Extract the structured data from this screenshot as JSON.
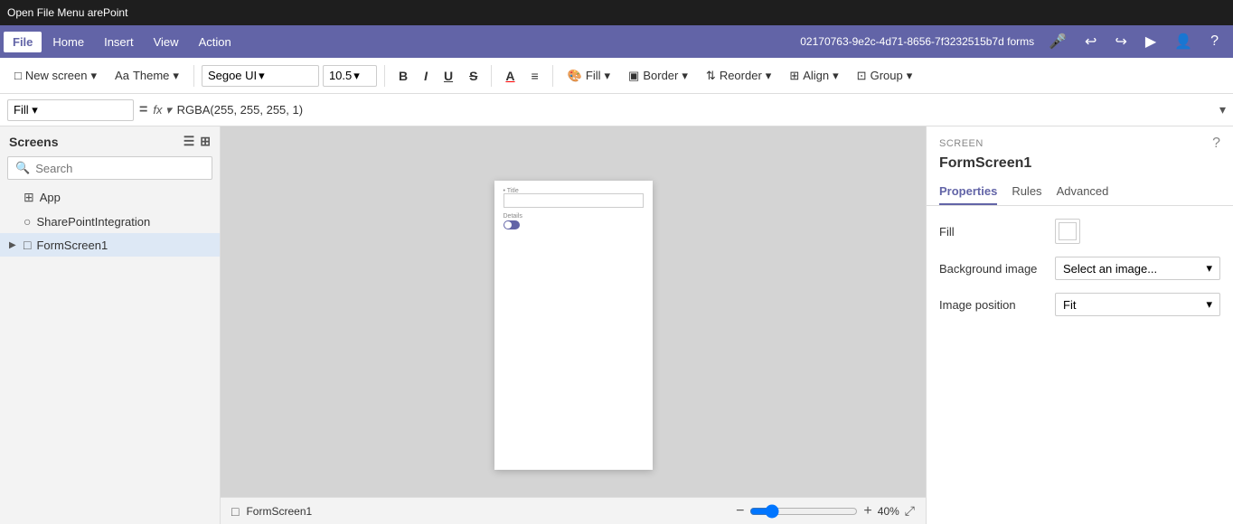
{
  "titleBar": {
    "text": "Open File Menu arePoint"
  },
  "menuBar": {
    "appId": "02170763-9e2c-4d71-8656-7f3232515b7d forms",
    "items": [
      {
        "id": "file",
        "label": "File",
        "active": true
      },
      {
        "id": "home",
        "label": "Home",
        "active": false
      },
      {
        "id": "insert",
        "label": "Insert",
        "active": false
      },
      {
        "id": "view",
        "label": "View",
        "active": false
      },
      {
        "id": "action",
        "label": "Action",
        "active": false
      }
    ],
    "icons": [
      "🎤",
      "↩",
      "↪",
      "▶",
      "👤",
      "?"
    ]
  },
  "toolbar": {
    "newScreen": "New screen",
    "theme": "Theme",
    "fontFamily": "Segoe UI",
    "fontSize": "10.5",
    "bold": "B",
    "italic": "I",
    "underline": "U",
    "strikethrough": "S",
    "fontColor": "A",
    "textAlign": "≡",
    "fill": "Fill",
    "border": "Border",
    "reorder": "Reorder",
    "align": "Align",
    "group": "Group"
  },
  "formulaBar": {
    "property": "Fill",
    "formula": "RGBA(255, 255, 255, 1)"
  },
  "screens": {
    "title": "Screens",
    "search": {
      "placeholder": "Search",
      "value": ""
    },
    "items": [
      {
        "id": "app",
        "label": "App",
        "icon": "⊞",
        "level": 0,
        "hasChevron": false
      },
      {
        "id": "sharepointintegration",
        "label": "SharePointIntegration",
        "icon": "○",
        "level": 0,
        "hasChevron": false
      },
      {
        "id": "formscreen1",
        "label": "FormScreen1",
        "icon": "□",
        "level": 0,
        "hasChevron": true,
        "selected": true
      }
    ]
  },
  "canvas": {
    "screenName": "FormScreen1",
    "titleLabel": "• Title",
    "detailsLabel": "Details"
  },
  "statusBar": {
    "screenName": "FormScreen1",
    "zoomMinus": "−",
    "zoomPlus": "+",
    "zoomValue": "40",
    "zoomUnit": "%",
    "expandIcon": "⤢"
  },
  "rightPanel": {
    "sectionLabel": "SCREEN",
    "title": "FormScreen1",
    "tabs": [
      {
        "id": "properties",
        "label": "Properties",
        "active": true
      },
      {
        "id": "rules",
        "label": "Rules",
        "active": false
      },
      {
        "id": "advanced",
        "label": "Advanced",
        "active": false
      }
    ],
    "properties": {
      "fill": {
        "label": "Fill",
        "swatchColor": "#ffffff"
      },
      "backgroundImage": {
        "label": "Background image",
        "value": "Select an image...",
        "chevron": "▾"
      },
      "imagePosition": {
        "label": "Image position",
        "value": "Fit",
        "chevron": "▾"
      }
    }
  }
}
